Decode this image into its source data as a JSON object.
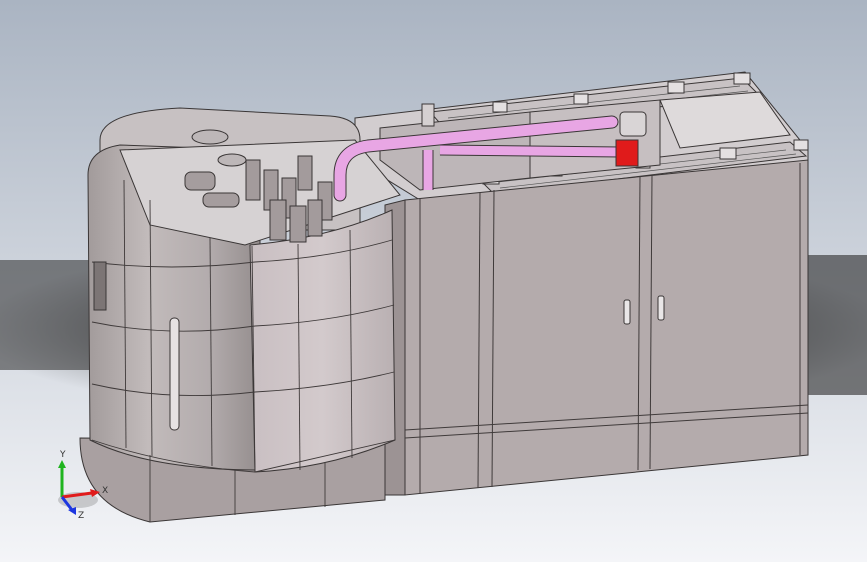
{
  "viewport": {
    "background_top": "#aab4c2",
    "background_bottom": "#f4f5f8"
  },
  "model": {
    "body_color": "#b7aeae",
    "body_shadow_color": "#9e9696",
    "top_color": "#d9d5d6",
    "edge_color": "#3a3636",
    "pipe_color": "#e8a6e4",
    "valve_color": "#e01b1b"
  },
  "triad": {
    "x_label": "X",
    "y_label": "Y",
    "z_label": "Z",
    "x_color": "#e01b1b",
    "y_color": "#1fb41f",
    "z_color": "#1c36e0"
  }
}
